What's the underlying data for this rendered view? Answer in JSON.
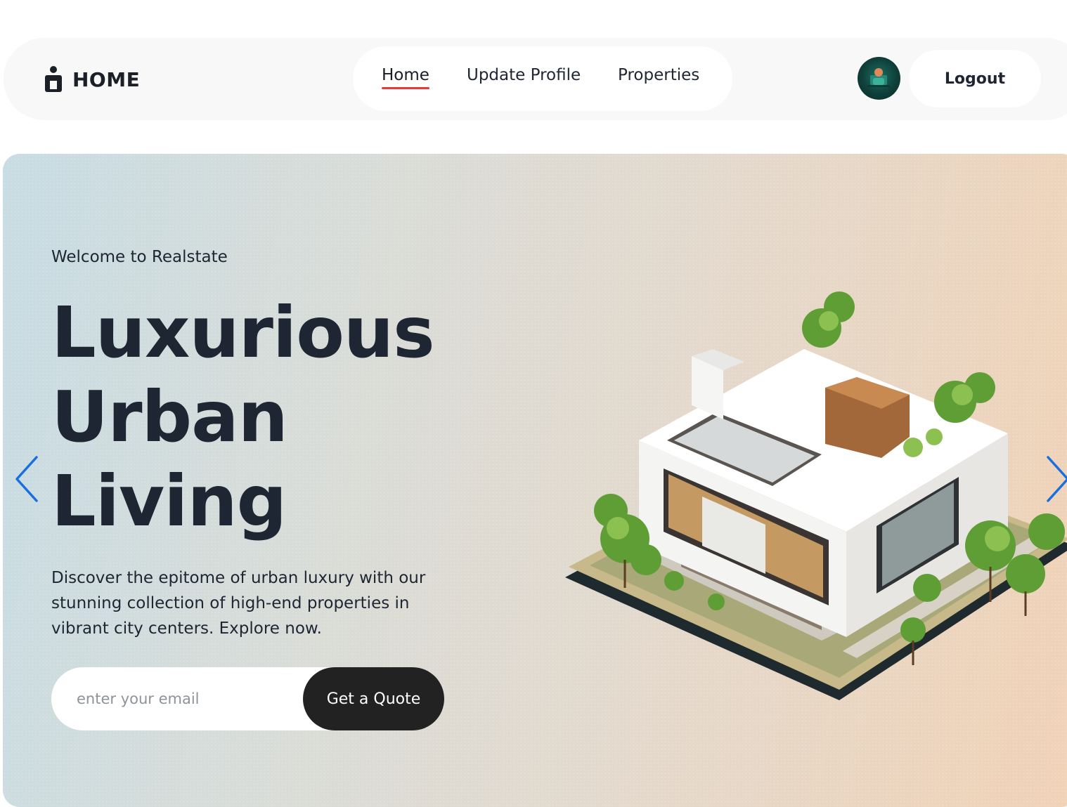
{
  "navbar": {
    "brand_label": "HOME",
    "brand_icon": "user-icon",
    "links": [
      {
        "label": "Home",
        "active": true
      },
      {
        "label": "Update Profile",
        "active": false
      },
      {
        "label": "Properties",
        "active": false
      }
    ],
    "active_underline_color": "#e23c3c",
    "logout_label": "Logout"
  },
  "hero": {
    "welcome": "Welcome to Realstate",
    "headline": [
      "Luxurious",
      "Urban",
      "Living"
    ],
    "description": "Discover the epitome of urban luxury with our stunning collection of high-end properties in vibrant city centers. Explore now.",
    "email_placeholder": "enter your email",
    "cta_label": "Get a Quote",
    "arrow_color": "#1a6fe0",
    "prev_icon": "chevron-left-icon",
    "next_icon": "chevron-right-icon",
    "image": "isometric-house-illustration"
  }
}
